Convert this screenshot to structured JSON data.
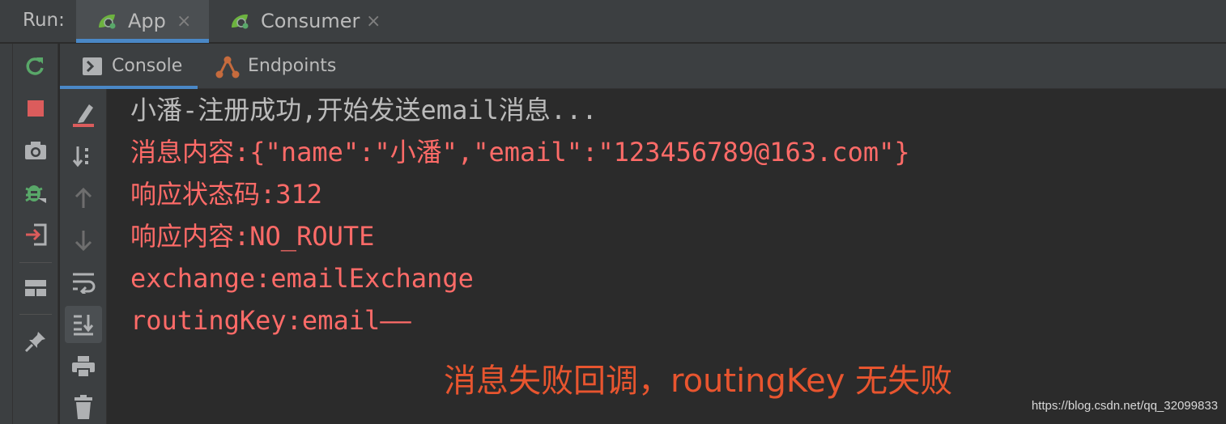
{
  "run_bar": {
    "label": "Run:",
    "tabs": [
      {
        "label": "App",
        "active": true
      },
      {
        "label": "Consumer",
        "active": false
      }
    ],
    "close_glyph": "×"
  },
  "console_tabs": {
    "console_label": "Console",
    "endpoints_label": "Endpoints"
  },
  "left_toolbar_icons": [
    "rerun-icon",
    "stop-icon",
    "camera-icon",
    "debug-icon",
    "exit-icon",
    "layout-icon",
    "pin-icon"
  ],
  "console_toolbar_icons": [
    "clear-icon",
    "sort-icon",
    "up-arrow-icon",
    "down-arrow-icon",
    "soft-wrap-icon",
    "scroll-to-end-icon",
    "print-icon",
    "trash-icon"
  ],
  "console": {
    "lines": [
      {
        "text": "小潘-注册成功,开始发送email消息...",
        "kind": "info"
      },
      {
        "text": "消息内容:{\"name\":\"小潘\",\"email\":\"123456789@163.com\"}",
        "kind": "err"
      },
      {
        "text": "响应状态码:312",
        "kind": "err"
      },
      {
        "text": "响应内容:NO_ROUTE",
        "kind": "err"
      },
      {
        "text": "exchange:emailExchange",
        "kind": "err"
      },
      {
        "text": "routingKey:email——",
        "kind": "err"
      }
    ]
  },
  "annotation": "消息失败回调，routingKey 无失败",
  "watermark": "https://blog.csdn.net/qq_32099833",
  "colors": {
    "background": "#2b2b2b",
    "panel": "#3c3f41",
    "accent_blue": "#4a88c7",
    "error_text": "#ff6b68",
    "annotation_text": "#e8552f",
    "spring_green": "#6db33f"
  }
}
